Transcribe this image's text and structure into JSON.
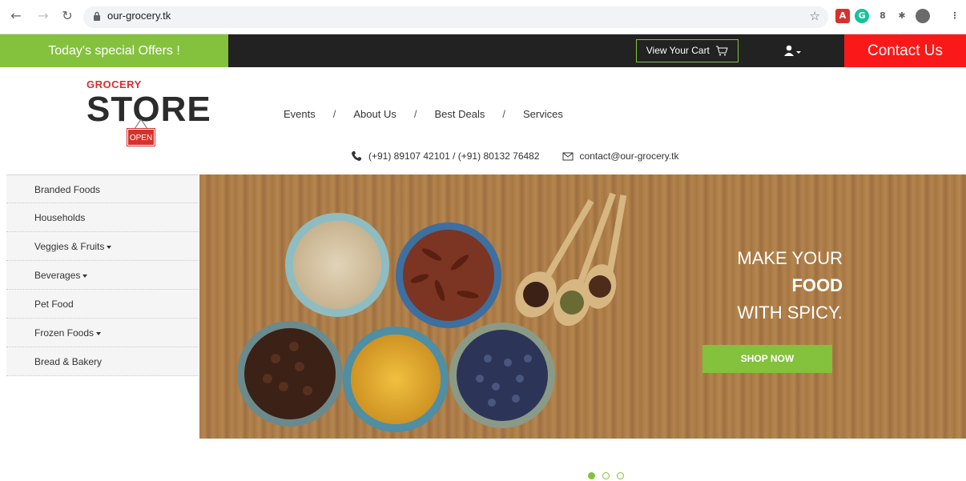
{
  "browser": {
    "url": "our-grocery.tk",
    "colors": {
      "ext_pdf": "#d8312c",
      "ext_grammarly": "#15c39a"
    }
  },
  "promo": {
    "offers_label": "Today's special Offers !",
    "cart_label": "View Your Cart",
    "contact_label": "Contact Us",
    "colors": {
      "green": "#84c13d",
      "red": "#fa1818",
      "dark": "#222222"
    }
  },
  "logo": {
    "top": "GROCERY",
    "main": "STORE",
    "sign": "OPEN"
  },
  "nav": {
    "items": [
      "Events",
      "About Us",
      "Best Deals",
      "Services"
    ],
    "separator": "/"
  },
  "contact": {
    "phones": "(+91) 89107 42101 / (+91) 80132 76482",
    "email": "contact@our-grocery.tk"
  },
  "sidebar": {
    "items": [
      {
        "label": "Branded Foods",
        "dropdown": false
      },
      {
        "label": "Households",
        "dropdown": false
      },
      {
        "label": "Veggies & Fruits",
        "dropdown": true
      },
      {
        "label": "Beverages",
        "dropdown": true
      },
      {
        "label": "Pet Food",
        "dropdown": false
      },
      {
        "label": "Frozen Foods",
        "dropdown": true
      },
      {
        "label": "Bread & Bakery",
        "dropdown": false
      }
    ]
  },
  "hero": {
    "line1": "MAKE YOUR",
    "line2": "FOOD",
    "line3": "WITH SPICY.",
    "button": "SHOP NOW"
  },
  "carousel": {
    "slides": 3,
    "active": 1
  }
}
